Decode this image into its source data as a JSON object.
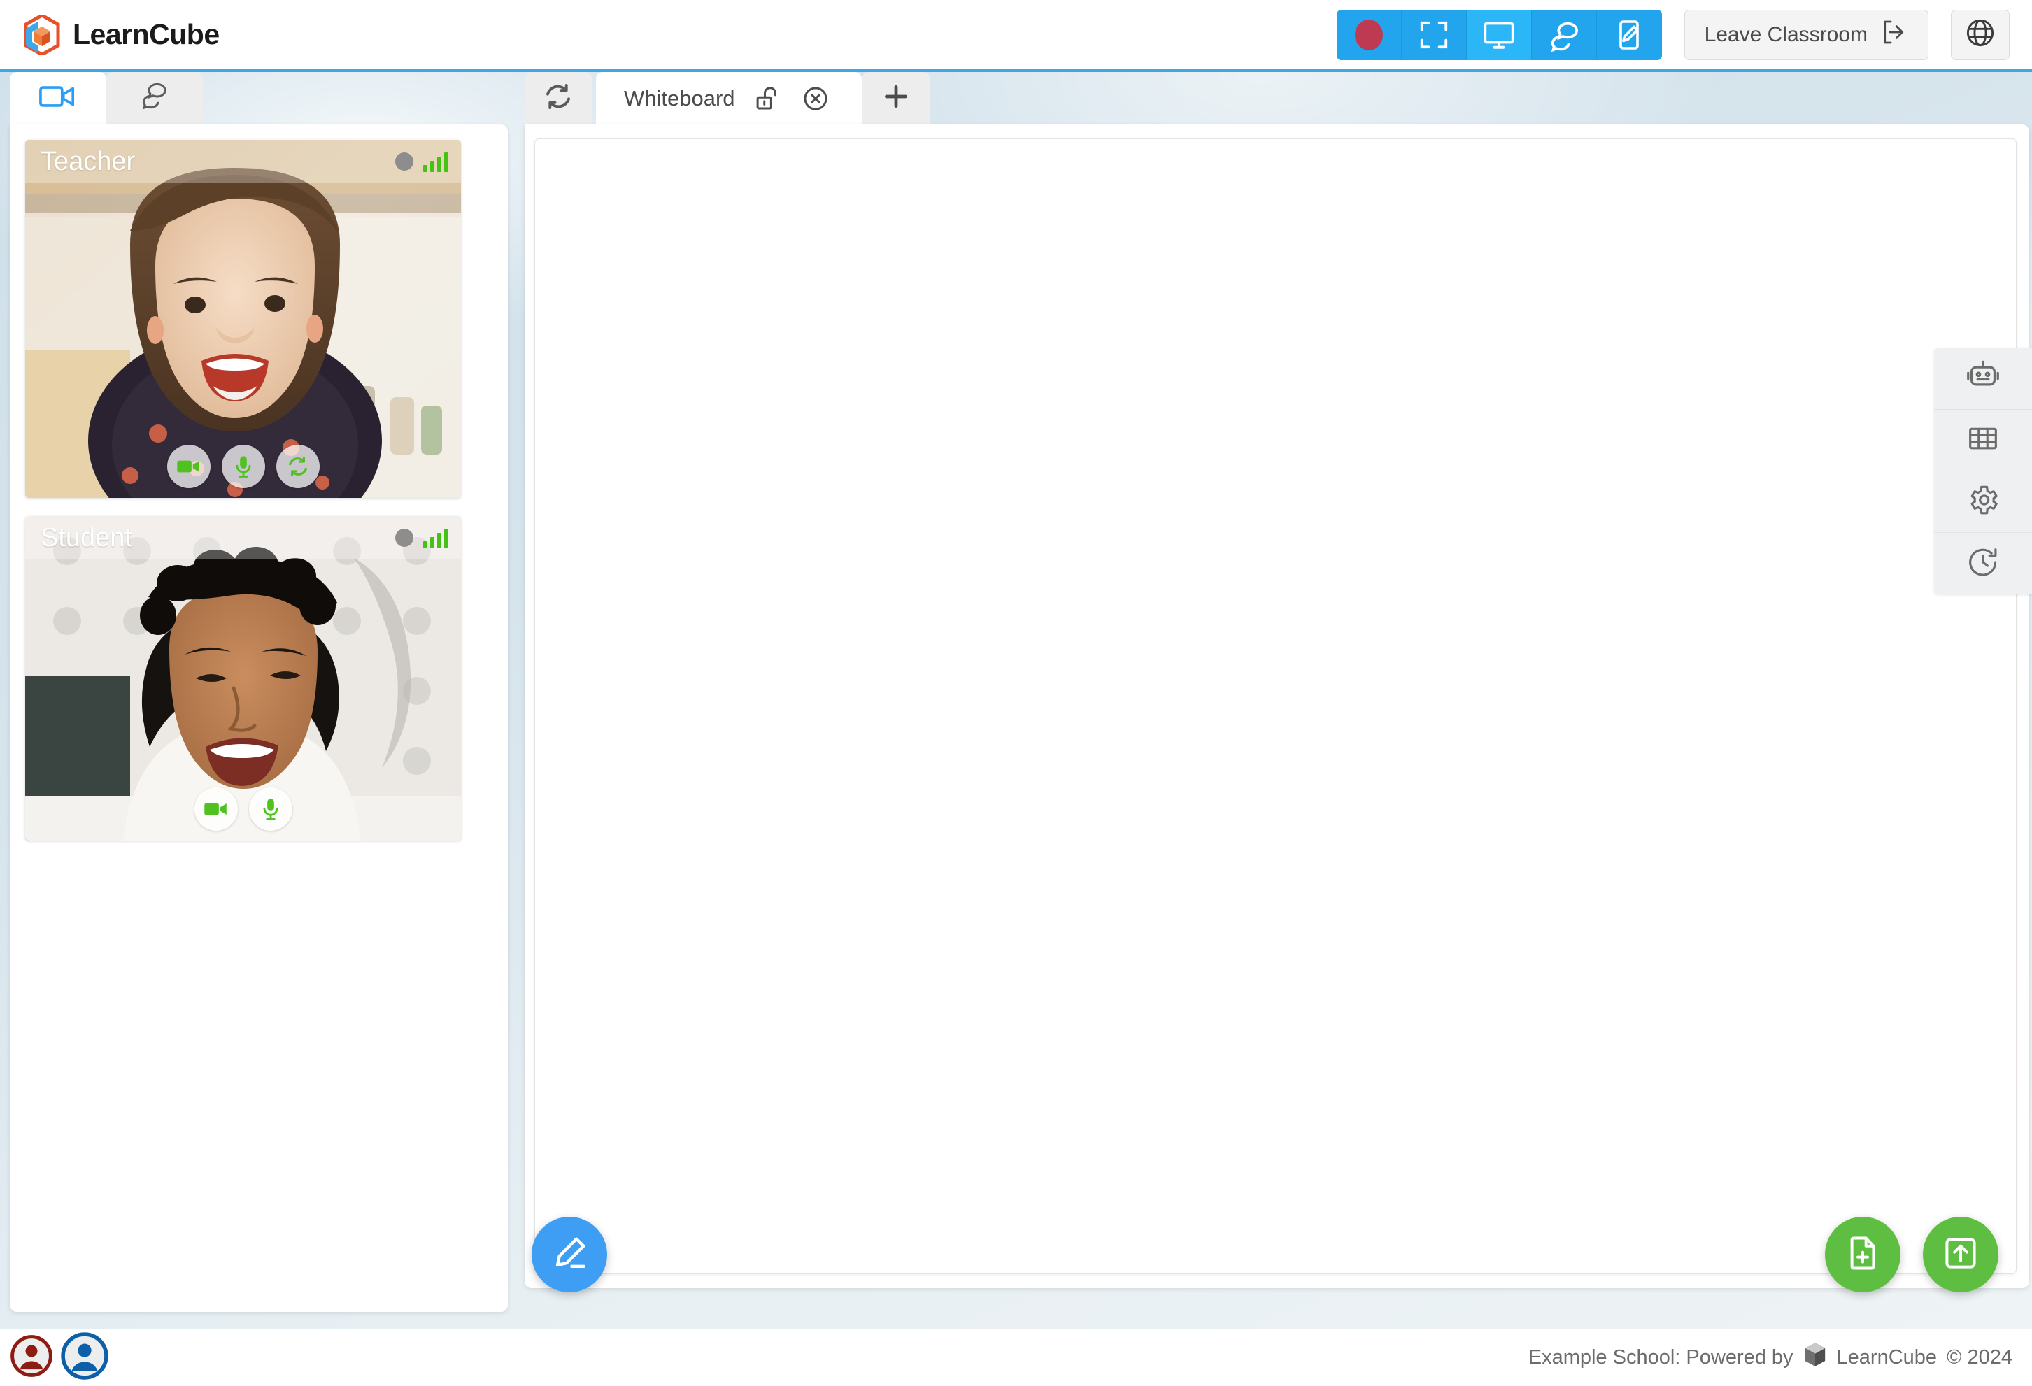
{
  "header": {
    "brand_name": "LearnCube",
    "brand_logo_icon": "learncube-hexcube-logo",
    "tools": [
      {
        "name": "record-button",
        "icon": "record-circle-icon",
        "label": "Record",
        "active": false
      },
      {
        "name": "fullscreen-button",
        "icon": "fullscreen-expand-icon",
        "label": "Fullscreen",
        "active": false
      },
      {
        "name": "screenshare-button",
        "icon": "monitor-screen-icon",
        "label": "Share Screen",
        "active": true
      },
      {
        "name": "chat-button",
        "icon": "chat-bubbles-icon",
        "label": "Chat",
        "active": false
      },
      {
        "name": "annotate-button",
        "icon": "pen-tablet-icon",
        "label": "Annotate",
        "active": false
      }
    ],
    "leave_label": "Leave Classroom",
    "leave_icon": "exit-arrow-icon",
    "language_icon": "globe-icon"
  },
  "sidebar": {
    "tabs": [
      {
        "name": "tab-video",
        "icon": "video-camera-icon",
        "active": true
      },
      {
        "name": "tab-chat",
        "icon": "chat-bubbles-icon",
        "active": false
      }
    ],
    "participants": [
      {
        "label": "Teacher",
        "status_dot_color": "#8d8d8d",
        "signal_icon": "signal-bars-icon",
        "controls": [
          {
            "name": "teacher-camera-toggle",
            "icon": "video-camera-icon"
          },
          {
            "name": "teacher-mic-toggle",
            "icon": "microphone-icon"
          },
          {
            "name": "teacher-swap-camera",
            "icon": "refresh-swap-icon"
          }
        ]
      },
      {
        "label": "Student",
        "status_dot_color": "#8d8d8d",
        "signal_icon": "signal-bars-icon",
        "controls": [
          {
            "name": "student-camera-toggle",
            "icon": "video-camera-icon"
          },
          {
            "name": "student-mic-toggle",
            "icon": "microphone-icon"
          }
        ]
      }
    ]
  },
  "main": {
    "refresh_icon": "refresh-icon",
    "tab": {
      "title": "Whiteboard",
      "lock_icon": "padlock-open-icon",
      "close_icon": "close-circle-icon"
    },
    "add_tab_icon": "plus-icon",
    "rail": [
      {
        "name": "rail-ai-assistant",
        "icon": "robot-icon"
      },
      {
        "name": "rail-grid",
        "icon": "grid-table-icon"
      },
      {
        "name": "rail-settings",
        "icon": "gear-icon"
      },
      {
        "name": "rail-history",
        "icon": "clock-history-icon"
      }
    ],
    "fabs": [
      {
        "name": "draw-tool-button",
        "icon": "pencil-icon",
        "color": "#3d9ef3"
      },
      {
        "name": "new-document-button",
        "icon": "document-plus-icon",
        "color": "#5ebe41"
      },
      {
        "name": "upload-button",
        "icon": "upload-arrow-icon",
        "color": "#5ebe41"
      }
    ]
  },
  "footer": {
    "avatars": [
      {
        "name": "avatar-teacher",
        "color": "#8d1c13"
      },
      {
        "name": "avatar-student",
        "color": "#0d5fa8"
      }
    ],
    "school_text": "Example School: Powered by",
    "cube_icon": "learncube-cube-icon",
    "product_name": "LearnCube",
    "copyright": "© 2024"
  },
  "colors": {
    "accent_blue": "#22a5ec",
    "accent_blue_active": "#2bb7f7",
    "record_red": "#bd3a52",
    "green": "#5ebe41",
    "signal_green": "#44c314",
    "header_rule": "#3da7e8"
  }
}
